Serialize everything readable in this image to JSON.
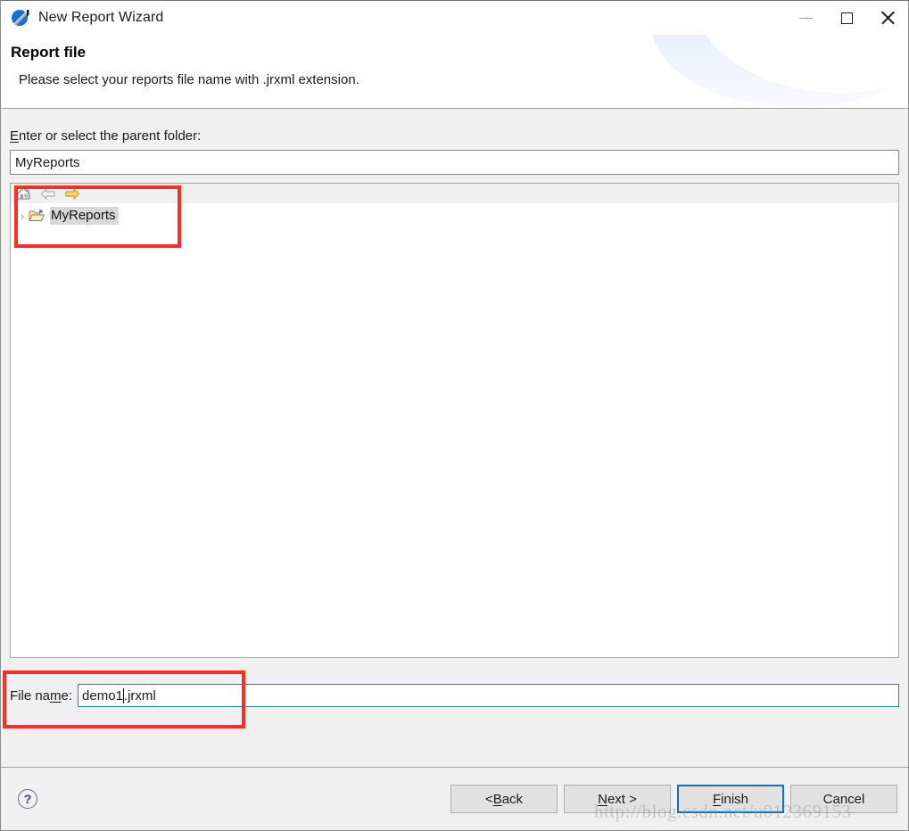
{
  "window": {
    "title": "New Report Wizard",
    "app_icon": "jasperreports-icon",
    "controls": {
      "minimize": "minimize-icon",
      "maximize": "maximize-icon",
      "close": "close-icon"
    }
  },
  "header": {
    "title": "Report file",
    "description": "Please select your reports file name with .jrxml extension."
  },
  "form": {
    "parent_folder_label_pre": "",
    "parent_folder_label_mnemonic": "E",
    "parent_folder_label_post": "nter or select the parent folder:",
    "parent_folder_label_full": "Enter or select the parent folder:",
    "parent_folder_value": "MyReports",
    "parent_folder_placeholder": "",
    "file_name_label_pre": "File na",
    "file_name_label_mnemonic": "m",
    "file_name_label_post": "e:",
    "file_name_label_full": "File name:",
    "file_name_value_before_caret": "demo1",
    "file_name_value_after_caret": ".jrxml",
    "file_name_value": "demo1.jrxml",
    "file_name_placeholder": ""
  },
  "tree": {
    "toolbar": [
      {
        "name": "home-icon",
        "title": "Home"
      },
      {
        "name": "back-arrow-icon",
        "title": "Back"
      },
      {
        "name": "forward-arrow-icon",
        "title": "Forward"
      }
    ],
    "items": [
      {
        "label": "MyReports",
        "expander": "›",
        "icon": "open-folder-icon",
        "selected": true
      }
    ]
  },
  "footer": {
    "help_label": "?",
    "buttons": [
      {
        "name": "back-button",
        "pre": "< ",
        "mnemonic": "B",
        "post": "ack",
        "full": "< Back",
        "primary": false
      },
      {
        "name": "next-button",
        "pre": "",
        "mnemonic": "N",
        "post": "ext >",
        "full": "Next >",
        "primary": false
      },
      {
        "name": "finish-button",
        "pre": "",
        "mnemonic": "F",
        "post": "inish",
        "full": "Finish",
        "primary": true
      },
      {
        "name": "cancel-button",
        "pre": "",
        "mnemonic": "",
        "post": "Cancel",
        "full": "Cancel",
        "primary": false
      }
    ]
  },
  "annotations": {
    "color": "#fa2d29",
    "boxes": [
      "tree-myreports-highlight",
      "file-name-field-highlight"
    ]
  },
  "watermark": {
    "text": "http://blog.csdn.net/u012369153"
  }
}
